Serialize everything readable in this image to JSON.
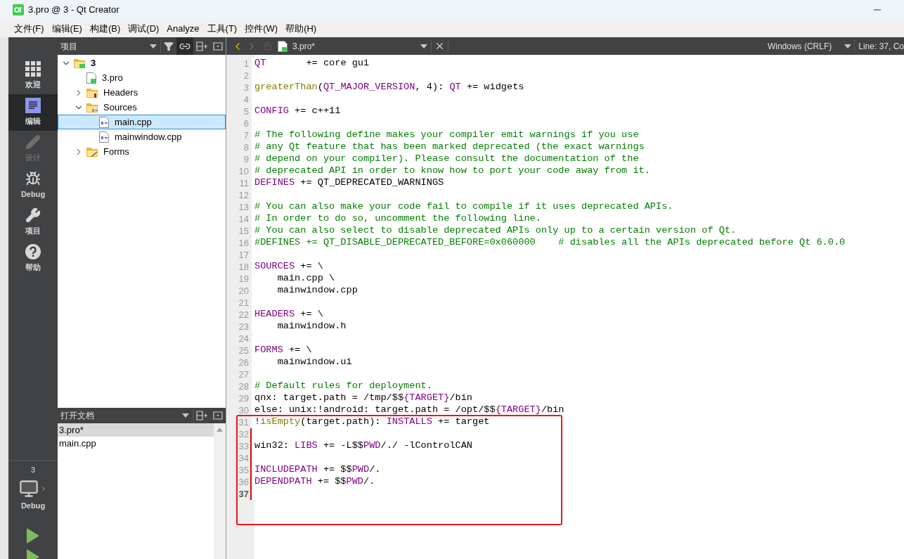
{
  "window": {
    "title": "3.pro @ 3 - Qt Creator"
  },
  "menu": [
    "文件(F)",
    "编辑(E)",
    "构建(B)",
    "调试(D)",
    "Analyze",
    "工具(T)",
    "控件(W)",
    "帮助(H)"
  ],
  "modes": [
    {
      "label": "欢迎",
      "kind": "welcome",
      "selected": false,
      "disabled": false
    },
    {
      "label": "编辑",
      "kind": "edit",
      "selected": true,
      "disabled": false
    },
    {
      "label": "设计",
      "kind": "design",
      "selected": false,
      "disabled": true
    },
    {
      "label": "Debug",
      "kind": "debug",
      "selected": false,
      "disabled": false
    },
    {
      "label": "项目",
      "kind": "project",
      "selected": false,
      "disabled": false
    },
    {
      "label": "帮助",
      "kind": "help",
      "selected": false,
      "disabled": false
    }
  ],
  "target": {
    "project": "3",
    "config": "Debug"
  },
  "project_pane": {
    "title": "项目",
    "link_active": true,
    "tree": [
      {
        "label": "3",
        "kind": "project",
        "expanded": true,
        "selected": false,
        "children": [
          {
            "label": "3.pro",
            "kind": "pro",
            "selected": false
          },
          {
            "label": "Headers",
            "kind": "headers",
            "expanded": false,
            "selected": false
          },
          {
            "label": "Sources",
            "kind": "sources",
            "expanded": true,
            "selected": false,
            "children": [
              {
                "label": "main.cpp",
                "kind": "cpp",
                "selected": true
              },
              {
                "label": "mainwindow.cpp",
                "kind": "cpp",
                "selected": false
              }
            ]
          },
          {
            "label": "Forms",
            "kind": "forms",
            "expanded": false,
            "selected": false
          }
        ]
      }
    ]
  },
  "open_documents": {
    "title": "打开文档",
    "items": [
      {
        "label": "3.pro*",
        "selected": true
      },
      {
        "label": "main.cpp",
        "selected": false
      }
    ]
  },
  "editor_toolbar": {
    "file": "3.pro*",
    "line_ending": "Windows (CRLF)",
    "position": "Line: 37, Co"
  },
  "code_lines": [
    {
      "number": "1",
      "current": false,
      "modified": false,
      "framed": false,
      "segments": [
        {
          "text": "QT",
          "kind": "keyword"
        },
        {
          "text": "       += core gui",
          "kind": "plain"
        }
      ]
    },
    {
      "number": "2",
      "current": false,
      "modified": false,
      "framed": false
    },
    {
      "number": "3",
      "current": false,
      "modified": false,
      "framed": false,
      "segments": [
        {
          "text": "greaterThan",
          "kind": "function"
        },
        {
          "text": "(",
          "kind": "plain"
        },
        {
          "text": "QT_MAJOR_VERSION",
          "kind": "keyword"
        },
        {
          "text": ", 4): ",
          "kind": "plain"
        },
        {
          "text": "QT",
          "kind": "keyword"
        },
        {
          "text": " += widgets",
          "kind": "plain"
        }
      ]
    },
    {
      "number": "4",
      "current": false,
      "modified": false,
      "framed": false
    },
    {
      "number": "5",
      "current": false,
      "modified": false,
      "framed": false,
      "segments": [
        {
          "text": "CONFIG",
          "kind": "keyword"
        },
        {
          "text": " += c++11",
          "kind": "plain"
        }
      ]
    },
    {
      "number": "6",
      "current": false,
      "modified": false,
      "framed": false
    },
    {
      "number": "7",
      "current": false,
      "modified": false,
      "framed": false,
      "segments": [
        {
          "text": "# The following define makes your compiler emit warnings if you use",
          "kind": "comment"
        }
      ]
    },
    {
      "number": "8",
      "current": false,
      "modified": false,
      "framed": false,
      "segments": [
        {
          "text": "# any Qt feature that has been marked deprecated (the exact warnings",
          "kind": "comment"
        }
      ]
    },
    {
      "number": "9",
      "current": false,
      "modified": false,
      "framed": false,
      "segments": [
        {
          "text": "# depend on your compiler). Please consult the documentation of the",
          "kind": "comment"
        }
      ]
    },
    {
      "number": "10",
      "current": false,
      "modified": false,
      "framed": false,
      "segments": [
        {
          "text": "# deprecated API in order to know how to port your code away from it.",
          "kind": "comment"
        }
      ]
    },
    {
      "number": "11",
      "current": false,
      "modified": false,
      "framed": false,
      "segments": [
        {
          "text": "DEFINES",
          "kind": "keyword"
        },
        {
          "text": " += QT_DEPRECATED_WARNINGS",
          "kind": "plain"
        }
      ]
    },
    {
      "number": "12",
      "current": false,
      "modified": false,
      "framed": false
    },
    {
      "number": "13",
      "current": false,
      "modified": false,
      "framed": false,
      "segments": [
        {
          "text": "# You can also make your code fail to compile if it uses deprecated APIs.",
          "kind": "comment"
        }
      ]
    },
    {
      "number": "14",
      "current": false,
      "modified": false,
      "framed": false,
      "segments": [
        {
          "text": "# In order to do so, uncomment the following line.",
          "kind": "comment"
        }
      ]
    },
    {
      "number": "15",
      "current": false,
      "modified": false,
      "framed": false,
      "segments": [
        {
          "text": "# You can also select to disable deprecated APIs only up to a certain version of Qt.",
          "kind": "comment"
        }
      ]
    },
    {
      "number": "16",
      "current": false,
      "modified": false,
      "framed": false,
      "segments": [
        {
          "text": "#DEFINES += QT_DISABLE_DEPRECATED_BEFORE=0x060000    # disables all the APIs deprecated before Qt 6.0.0",
          "kind": "comment"
        }
      ]
    },
    {
      "number": "17",
      "current": false,
      "modified": false,
      "framed": false
    },
    {
      "number": "18",
      "current": false,
      "modified": false,
      "framed": false,
      "segments": [
        {
          "text": "SOURCES",
          "kind": "keyword"
        },
        {
          "text": " += \\",
          "kind": "plain"
        }
      ]
    },
    {
      "number": "19",
      "current": false,
      "modified": false,
      "framed": false,
      "segments": [
        {
          "text": "    main.cpp \\",
          "kind": "plain"
        }
      ]
    },
    {
      "number": "20",
      "current": false,
      "modified": false,
      "framed": false,
      "segments": [
        {
          "text": "    mainwindow.cpp",
          "kind": "plain"
        }
      ]
    },
    {
      "number": "21",
      "current": false,
      "modified": false,
      "framed": false
    },
    {
      "number": "22",
      "current": false,
      "modified": false,
      "framed": false,
      "segments": [
        {
          "text": "HEADERS",
          "kind": "keyword"
        },
        {
          "text": " += \\",
          "kind": "plain"
        }
      ]
    },
    {
      "number": "23",
      "current": false,
      "modified": false,
      "framed": false,
      "segments": [
        {
          "text": "    mainwindow.h",
          "kind": "plain"
        }
      ]
    },
    {
      "number": "24",
      "current": false,
      "modified": false,
      "framed": false
    },
    {
      "number": "25",
      "current": false,
      "modified": false,
      "framed": false,
      "segments": [
        {
          "text": "FORMS",
          "kind": "keyword"
        },
        {
          "text": " += \\",
          "kind": "plain"
        }
      ]
    },
    {
      "number": "26",
      "current": false,
      "modified": false,
      "framed": false,
      "segments": [
        {
          "text": "    mainwindow.ui",
          "kind": "plain"
        }
      ]
    },
    {
      "number": "27",
      "current": false,
      "modified": false,
      "framed": false
    },
    {
      "number": "28",
      "current": false,
      "modified": false,
      "framed": false,
      "segments": [
        {
          "text": "# Default rules for deployment.",
          "kind": "comment"
        }
      ]
    },
    {
      "number": "29",
      "current": false,
      "modified": false,
      "framed": false,
      "segments": [
        {
          "text": "qnx: target.path = /tmp/$$",
          "kind": "plain"
        },
        {
          "text": "{TARGET}",
          "kind": "keyword"
        },
        {
          "text": "/bin",
          "kind": "plain"
        }
      ]
    },
    {
      "number": "30",
      "current": false,
      "modified": false,
      "framed": false,
      "segments": [
        {
          "text": "else: unix:!android: target.path = /opt/$$",
          "kind": "plain"
        },
        {
          "text": "{TARGET}",
          "kind": "keyword"
        },
        {
          "text": "/bin",
          "kind": "plain"
        }
      ]
    },
    {
      "number": "31",
      "current": false,
      "modified": false,
      "framed": true,
      "segments": [
        {
          "text": "!",
          "kind": "plain"
        },
        {
          "text": "isEmpty",
          "kind": "function"
        },
        {
          "text": "(target.path): ",
          "kind": "plain"
        },
        {
          "text": "INSTALLS",
          "kind": "keyword"
        },
        {
          "text": " += target",
          "kind": "plain"
        }
      ]
    },
    {
      "number": "32",
      "current": false,
      "modified": true,
      "framed": true
    },
    {
      "number": "33",
      "current": false,
      "modified": true,
      "framed": true,
      "segments": [
        {
          "text": "win32: ",
          "kind": "plain"
        },
        {
          "text": "LIBS",
          "kind": "keyword"
        },
        {
          "text": " += -L$$",
          "kind": "plain"
        },
        {
          "text": "PWD",
          "kind": "keyword"
        },
        {
          "text": "/./ -lControlCAN",
          "kind": "plain"
        }
      ]
    },
    {
      "number": "34",
      "current": false,
      "modified": true,
      "framed": true
    },
    {
      "number": "35",
      "current": false,
      "modified": true,
      "framed": true,
      "segments": [
        {
          "text": "INCLUDEPATH",
          "kind": "keyword"
        },
        {
          "text": " += $$",
          "kind": "plain"
        },
        {
          "text": "PWD",
          "kind": "keyword"
        },
        {
          "text": "/.",
          "kind": "plain"
        }
      ]
    },
    {
      "number": "36",
      "current": false,
      "modified": true,
      "framed": true,
      "segments": [
        {
          "text": "DEPENDPATH",
          "kind": "keyword"
        },
        {
          "text": " += $$",
          "kind": "plain"
        },
        {
          "text": "PWD",
          "kind": "keyword"
        },
        {
          "text": "/.",
          "kind": "plain"
        }
      ]
    },
    {
      "number": "37",
      "current": true,
      "modified": true,
      "framed": true
    }
  ]
}
